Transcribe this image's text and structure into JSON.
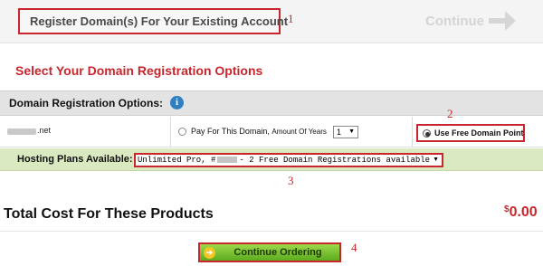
{
  "topbar": {
    "register_button_label": "Register Domain(s) For Your Existing Account",
    "continue_label": "Continue",
    "annotation_1": "1"
  },
  "section_heading": "Select Your Domain Registration Options",
  "options": {
    "header_title": "Domain Registration Options:",
    "info_icon": "info-icon",
    "domain_tld": ".net",
    "pay_label": "Pay For This Domain,",
    "amount_label": "Amount Of Years",
    "years_value": "1",
    "free_label": "Use Free Domain Point",
    "annotation_2": "2"
  },
  "hosting": {
    "label": "Hosting Plans Available:",
    "plan_prefix": "Unlimited Pro, #",
    "plan_suffix": "- 2 Free Domain Registrations available",
    "annotation_3": "3"
  },
  "total": {
    "label": "Total Cost For These Products",
    "currency": "$",
    "amount": "0.00"
  },
  "footer": {
    "continue_ordering_label": "Continue Ordering",
    "annotation_4": "4"
  },
  "colors": {
    "accent_red": "#c8262c",
    "hosting_green": "#dbe9c0",
    "button_green": "#5cab1e"
  }
}
